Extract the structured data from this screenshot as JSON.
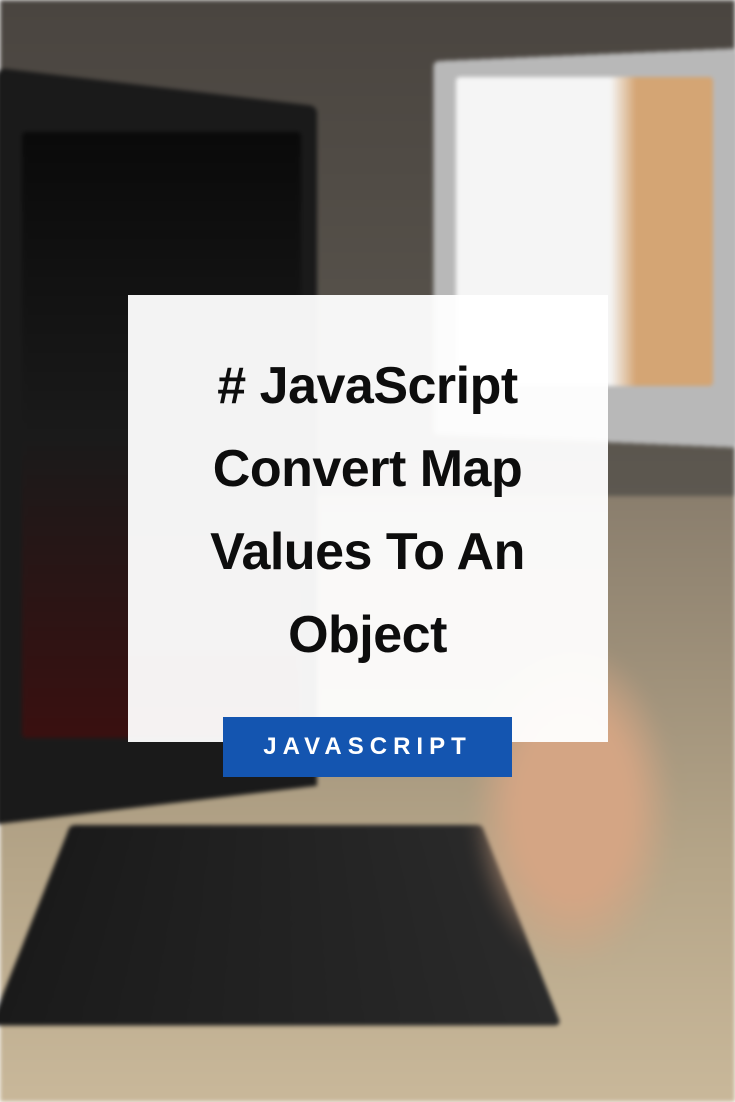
{
  "title": "# JavaScript Convert Map Values To An Object",
  "category_label": "JAVASCRIPT",
  "colors": {
    "badge_bg": "#1455b0",
    "badge_text": "#ffffff",
    "card_bg": "rgba(255, 255, 255, 0.95)",
    "title_text": "#0d0d0d"
  }
}
